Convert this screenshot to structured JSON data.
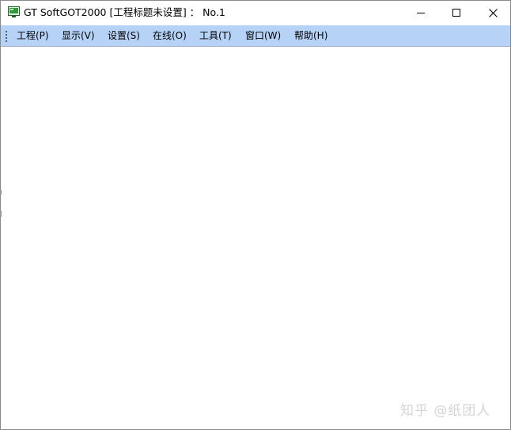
{
  "window": {
    "title": "GT SoftGOT2000  [工程标题未设置] ： No.1"
  },
  "menu": {
    "items": [
      {
        "label": "工程(P)"
      },
      {
        "label": "显示(V)"
      },
      {
        "label": "设置(S)"
      },
      {
        "label": "在线(O)"
      },
      {
        "label": "工具(T)"
      },
      {
        "label": "窗口(W)"
      },
      {
        "label": "帮助(H)"
      }
    ]
  },
  "watermark": {
    "text": "知乎 @纸团人"
  },
  "icons": {
    "app": "monitor-icon",
    "minimize": "minimize-icon",
    "maximize": "maximize-icon",
    "close": "close-icon",
    "grip": "toolbar-grip-icon"
  },
  "colors": {
    "menubar_bg": "#b7d2f7",
    "app_icon_green": "#2f9a3a"
  }
}
